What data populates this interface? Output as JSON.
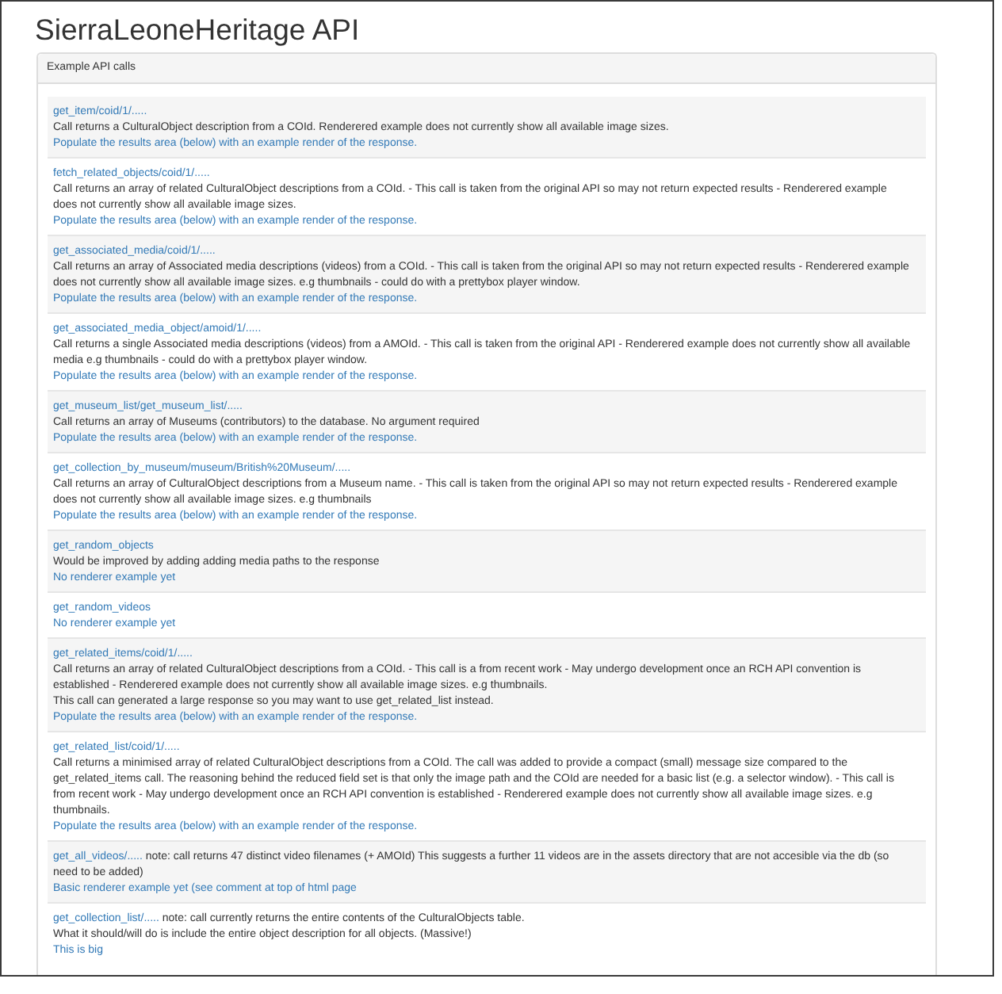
{
  "title": "SierraLeoneHeritage API",
  "panel": {
    "heading": "Example API calls",
    "items": [
      {
        "endpoint": "get_item/coid/1/.....",
        "description": [
          "Call returns a CulturalObject description from a COId. Renderered example does not currently show all available image sizes."
        ],
        "action": "Populate the results area (below) with an example render of the response."
      },
      {
        "endpoint": "fetch_related_objects/coid/1/.....",
        "description": [
          "Call returns an array of related CulturalObject descriptions from a COId. - This call is taken from the original API so may not return expected results - Renderered example does not currently show all available image sizes."
        ],
        "action": "Populate the results area (below) with an example render of the response."
      },
      {
        "endpoint": "get_associated_media/coid/1/.....",
        "description": [
          "Call returns an array of Associated media descriptions (videos) from a COId. - This call is taken from the original API so may not return expected results - Renderered example does not currently show all available image sizes. e.g thumbnails - could do with a prettybox player window."
        ],
        "action": "Populate the results area (below) with an example render of the response."
      },
      {
        "endpoint": "get_associated_media_object/amoid/1/.....",
        "description": [
          "Call returns a single Associated media descriptions (videos) from a AMOId. - This call is taken from the original API - Renderered example does not currently show all available media e.g thumbnails - could do with a prettybox player window."
        ],
        "action": "Populate the results area (below) with an example render of the response."
      },
      {
        "endpoint": "get_museum_list/get_museum_list/.....",
        "description": [
          "Call returns an array of Museums (contributors) to the database. No argument required"
        ],
        "action": "Populate the results area (below) with an example render of the response."
      },
      {
        "endpoint": "get_collection_by_museum/museum/British%20Museum/.....",
        "description": [
          "Call returns an array of CulturalObject descriptions from a Museum name. - This call is taken from the original API so may not return expected results - Renderered example does not currently show all available image sizes. e.g thumbnails"
        ],
        "action": "Populate the results area (below) with an example render of the response."
      },
      {
        "endpoint": "get_random_objects",
        "description": [
          "Would be improved by adding adding media paths to the response"
        ],
        "action": "No renderer example yet"
      },
      {
        "endpoint": "get_random_videos",
        "action": "No renderer example yet"
      },
      {
        "endpoint": "get_related_items/coid/1/.....",
        "description": [
          "Call returns an array of related CulturalObject descriptions from a COId. - This call is a from recent work - May undergo development once an RCH API convention is established - Renderered example does not currently show all available image sizes. e.g thumbnails.",
          "This call can generated a large response so you may want to use get_related_list instead."
        ],
        "action": "Populate the results area (below) with an example render of the response."
      },
      {
        "endpoint": "get_related_list/coid/1/.....",
        "description": [
          "Call returns a minimised array of related CulturalObject descriptions from a COId. The call was added to provide a compact (small) message size compared to the get_related_items call. The reasoning behind the reduced field set is that only the image path and the COId are needed for a basic list (e.g. a selector window). - This call is from recent work - May undergo development once an RCH API convention is established - Renderered example does not currently show all available image sizes. e.g thumbnails."
        ],
        "action": "Populate the results area (below) with an example render of the response."
      },
      {
        "endpoint": "get_all_videos/.....",
        "note": "note: call returns 47 distinct video filenames (+ AMOId) This suggests a further 11 videos are in the assets directory that are not accesible via the db (so need to be added)",
        "action": "Basic renderer example yet (see comment at top of html page"
      },
      {
        "endpoint": "get_collection_list/.....",
        "note": "note: call currently returns the entire contents of the CulturalObjects table.",
        "description": [
          "What it should/will do is include the entire object description for all objects. (Massive!)"
        ],
        "action": "This is big"
      }
    ]
  }
}
